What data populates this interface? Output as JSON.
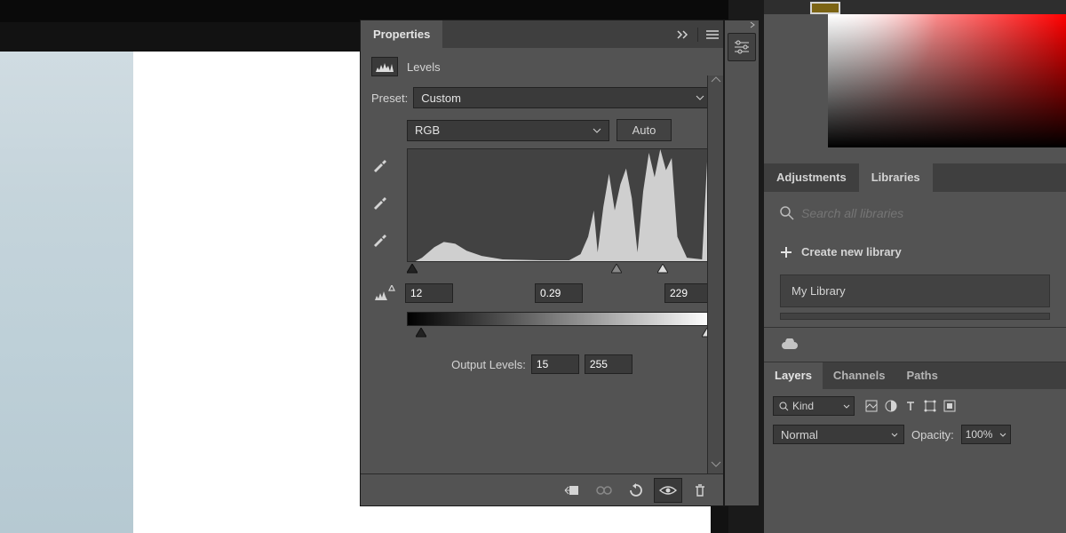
{
  "panel": {
    "title": "Properties",
    "adjustment_name": "Levels",
    "preset_label": "Preset:",
    "preset_value": "Custom",
    "channel_value": "RGB",
    "auto_label": "Auto",
    "input_black": "12",
    "input_gamma": "0.29",
    "input_white": "229",
    "output_label": "Output Levels:",
    "output_black": "15",
    "output_white": "255"
  },
  "right": {
    "tabs": {
      "adjustments": "Adjustments",
      "libraries": "Libraries"
    },
    "search_placeholder": "Search all libraries",
    "create_label": "Create new library",
    "lib1": "My Library",
    "layers_tabs": {
      "layers": "Layers",
      "channels": "Channels",
      "paths": "Paths"
    },
    "kind_label": "Kind",
    "blend_mode": "Normal",
    "opacity_label": "Opacity:",
    "opacity_value": "100%"
  },
  "colors": {
    "swatch": "#7c6414"
  }
}
